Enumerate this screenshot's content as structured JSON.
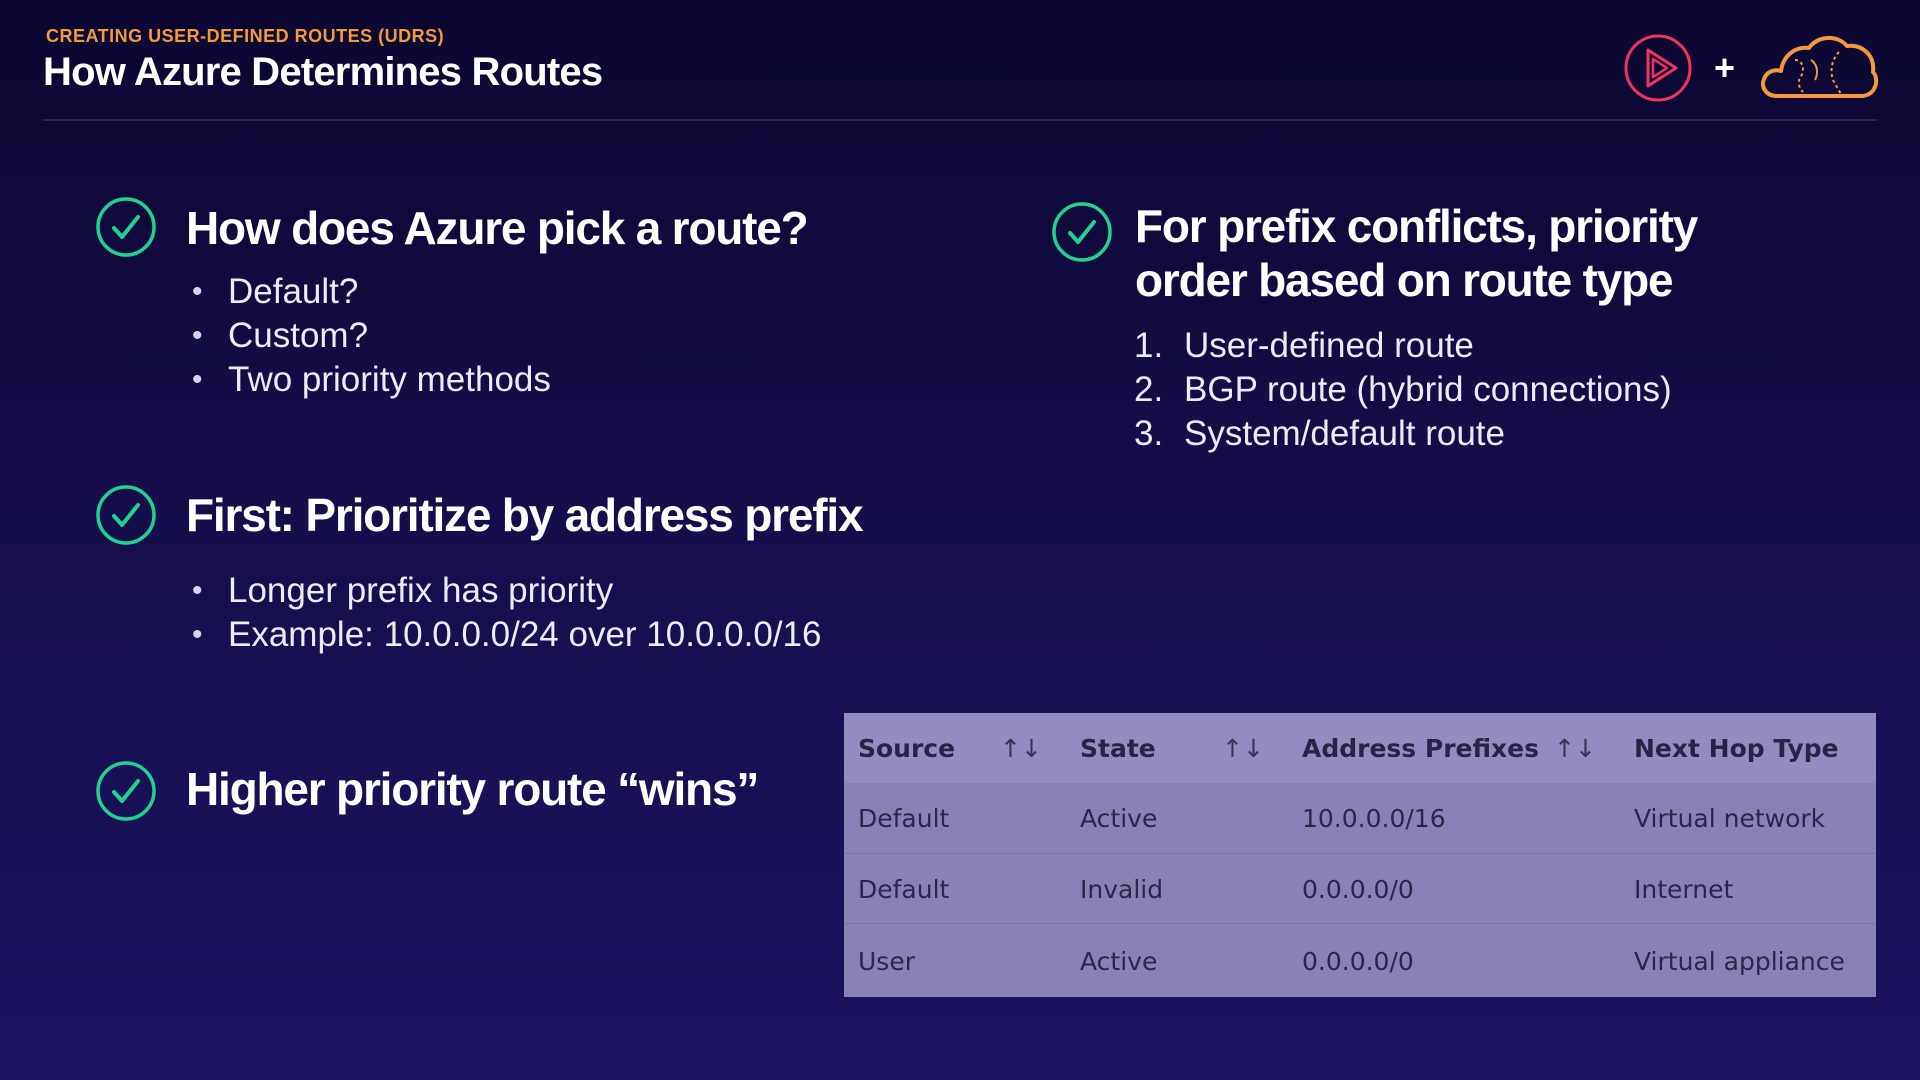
{
  "header": {
    "eyebrow": "CREATING USER-DEFINED ROUTES (UDRS)",
    "title": "How Azure Determines Routes",
    "plus": "+"
  },
  "colors": {
    "accent_orange": "#f29a3c",
    "check_green": "#1fd38f",
    "play_logo": "#f0345f",
    "background": "#140d48",
    "table_bg": "#8a81b7"
  },
  "icons": {
    "check": "check-circle-icon",
    "play_logo": "play-logo-icon",
    "cloud_logo": "cloud-logo-icon",
    "sort": "sort-arrows-icon"
  },
  "sections": [
    {
      "heading": "How does Azure pick a route?",
      "bullets": [
        "Default?",
        "Custom?",
        "Two priority methods"
      ]
    },
    {
      "heading": "First: Prioritize by address prefix",
      "bullets": [
        "Longer prefix has priority",
        "Example: 10.0.0.0/24 over 10.0.0.0/16"
      ]
    },
    {
      "heading": "Higher priority route “wins”"
    },
    {
      "heading_lines": [
        "For prefix conflicts, priority",
        "order based on route type"
      ],
      "items": [
        {
          "num": "1.",
          "text": "User-defined route"
        },
        {
          "num": "2.",
          "text": "BGP route (hybrid connections)"
        },
        {
          "num": "3.",
          "text": "System/default route"
        }
      ]
    }
  ],
  "table": {
    "columns": [
      "Source",
      "State",
      "Address Prefixes",
      "Next Hop Type"
    ],
    "sort_glyph": "↑↓",
    "rows": [
      [
        "Default",
        "Active",
        "10.0.0.0/16",
        "Virtual network"
      ],
      [
        "Default",
        "Invalid",
        "0.0.0.0/0",
        "Internet"
      ],
      [
        "User",
        "Active",
        "0.0.0.0/0",
        "Virtual appliance"
      ]
    ]
  }
}
